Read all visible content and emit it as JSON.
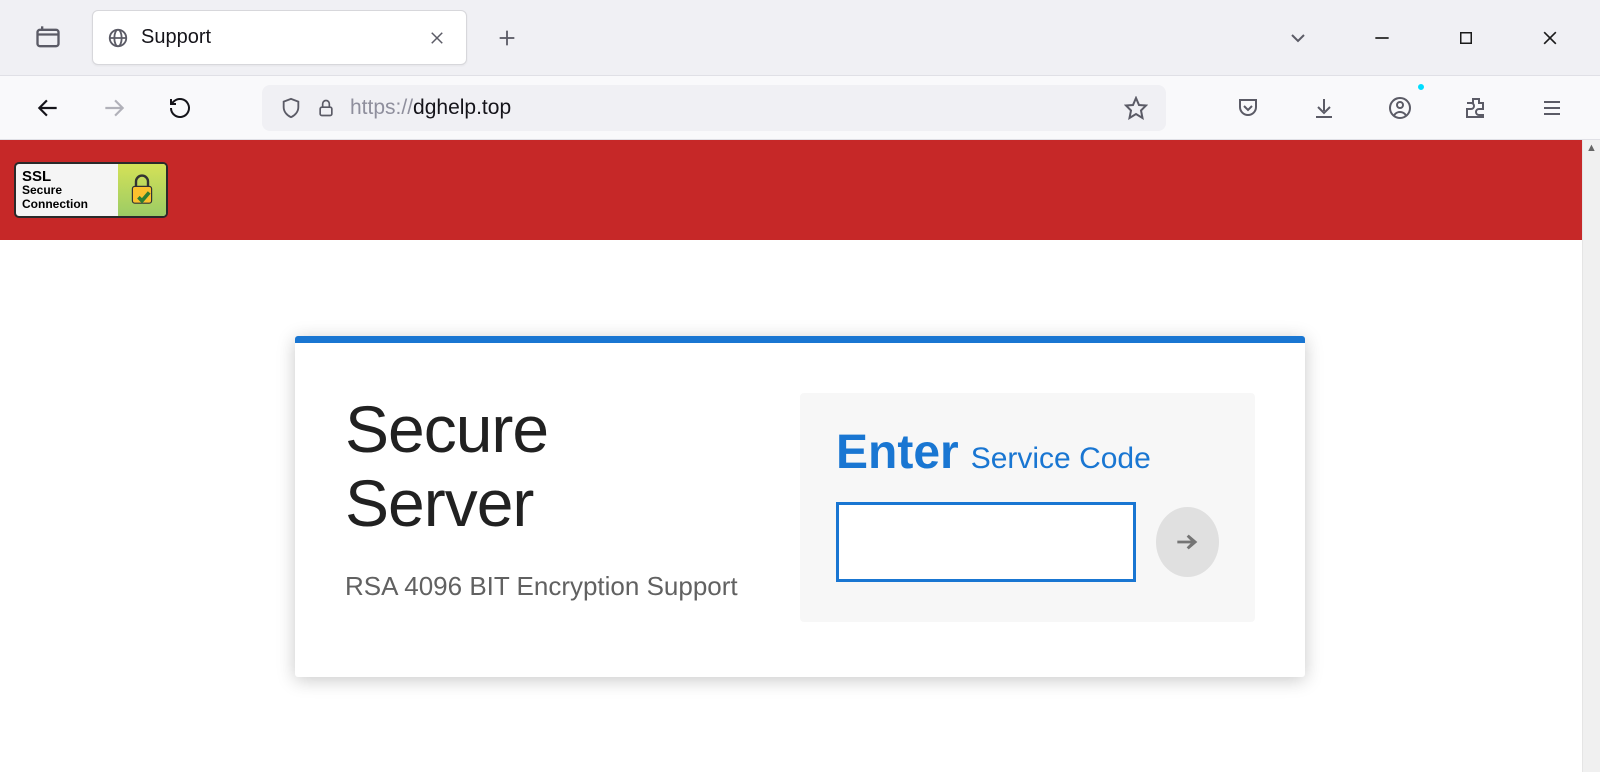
{
  "browser": {
    "tab_title": "Support",
    "url_scheme": "https://",
    "url_domain": "dghelp.top",
    "account_notification": true
  },
  "page": {
    "ssl_badge": {
      "line1": "SSL",
      "line2": "Secure",
      "line3": "Connection"
    },
    "heading_line1": "Secure",
    "heading_line2": "Server",
    "subheading": "RSA 4096 BIT Encryption Support",
    "form": {
      "enter_bold": "Enter",
      "enter_rest": "Service Code",
      "code_value": "",
      "code_placeholder": ""
    }
  },
  "colors": {
    "red": "#c62828",
    "blue": "#1976d2"
  }
}
